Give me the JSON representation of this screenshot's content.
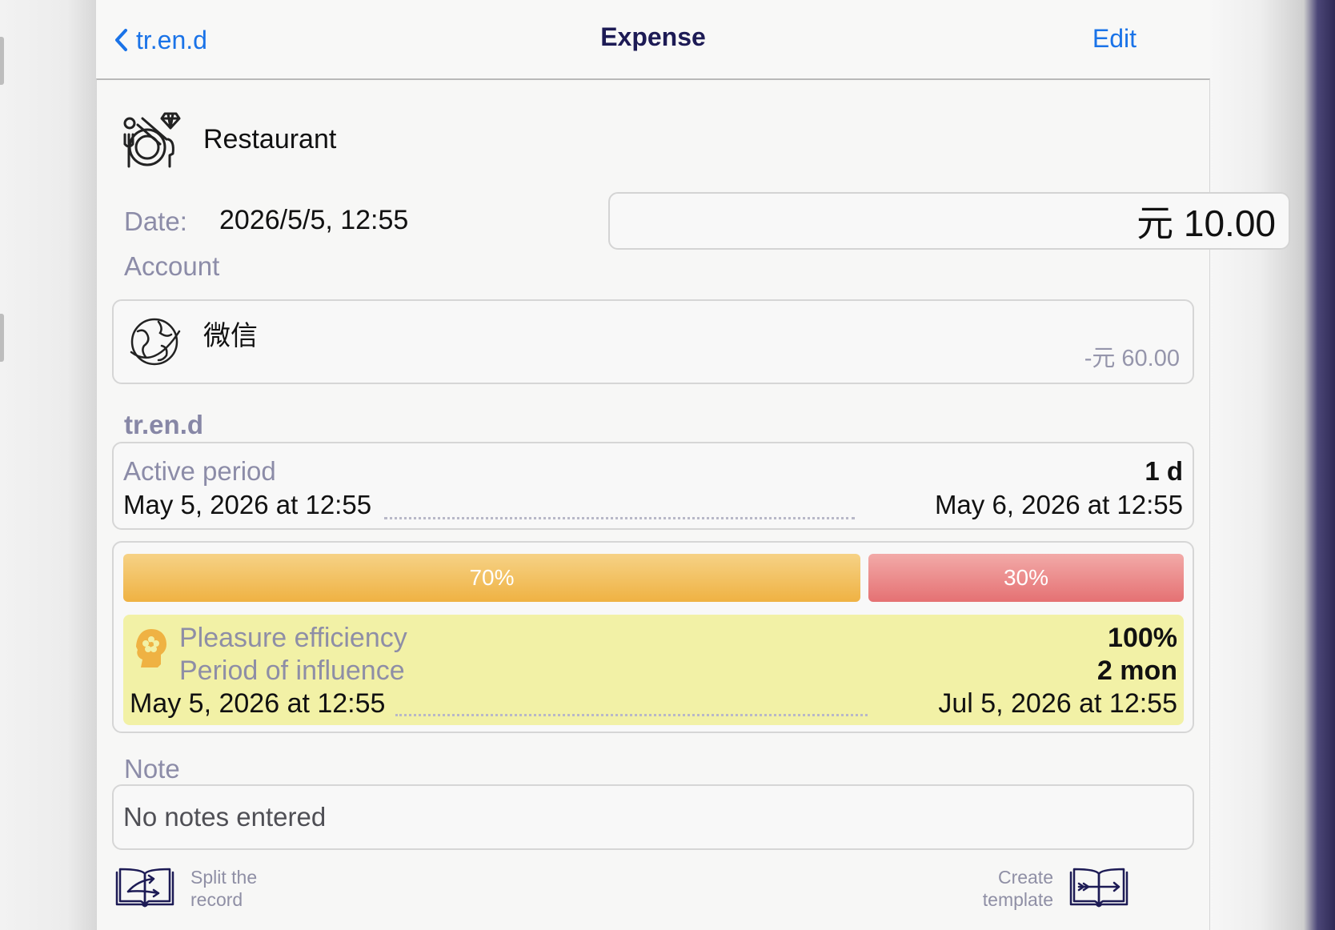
{
  "nav": {
    "back_label": "tr.en.d",
    "title": "Expense",
    "edit_label": "Edit"
  },
  "category": {
    "label": "Restaurant",
    "icon": "restaurant-icon"
  },
  "date": {
    "label": "Date:",
    "value": "2026/5/5, 12:55"
  },
  "amount": {
    "value": "元 10.00"
  },
  "account": {
    "section_label": "Account",
    "name": "微信",
    "balance": "-元 60.00",
    "icon": "globe-icon"
  },
  "trend": {
    "section_label": "tr.en.d",
    "active_period_label": "Active period",
    "active_period_duration": "1 d",
    "active_start": "May 5, 2026 at 12:55",
    "active_end": "May 6, 2026 at 12:55"
  },
  "split": {
    "first_percent": 70,
    "first_label": "70%",
    "second_percent": 30,
    "second_label": "30%",
    "first_color": "#efb243",
    "second_color": "#e57173"
  },
  "pleasure": {
    "efficiency_label": "Pleasure efficiency",
    "efficiency_value": "100%",
    "influence_label": "Period of influence",
    "influence_value": "2 mon",
    "influence_start": "May 5, 2026 at 12:55",
    "influence_end": "Jul 5, 2026 at 12:55",
    "panel_color": "#f2f1a6"
  },
  "note": {
    "section_label": "Note",
    "text": "No notes entered"
  },
  "actions": {
    "split_line1": "Split the",
    "split_line2": "record",
    "create_line1": "Create",
    "create_line2": "template"
  },
  "colors": {
    "accent": "#1a73e8",
    "title": "#1d1b55",
    "secondary_text": "#8c8ca8"
  }
}
